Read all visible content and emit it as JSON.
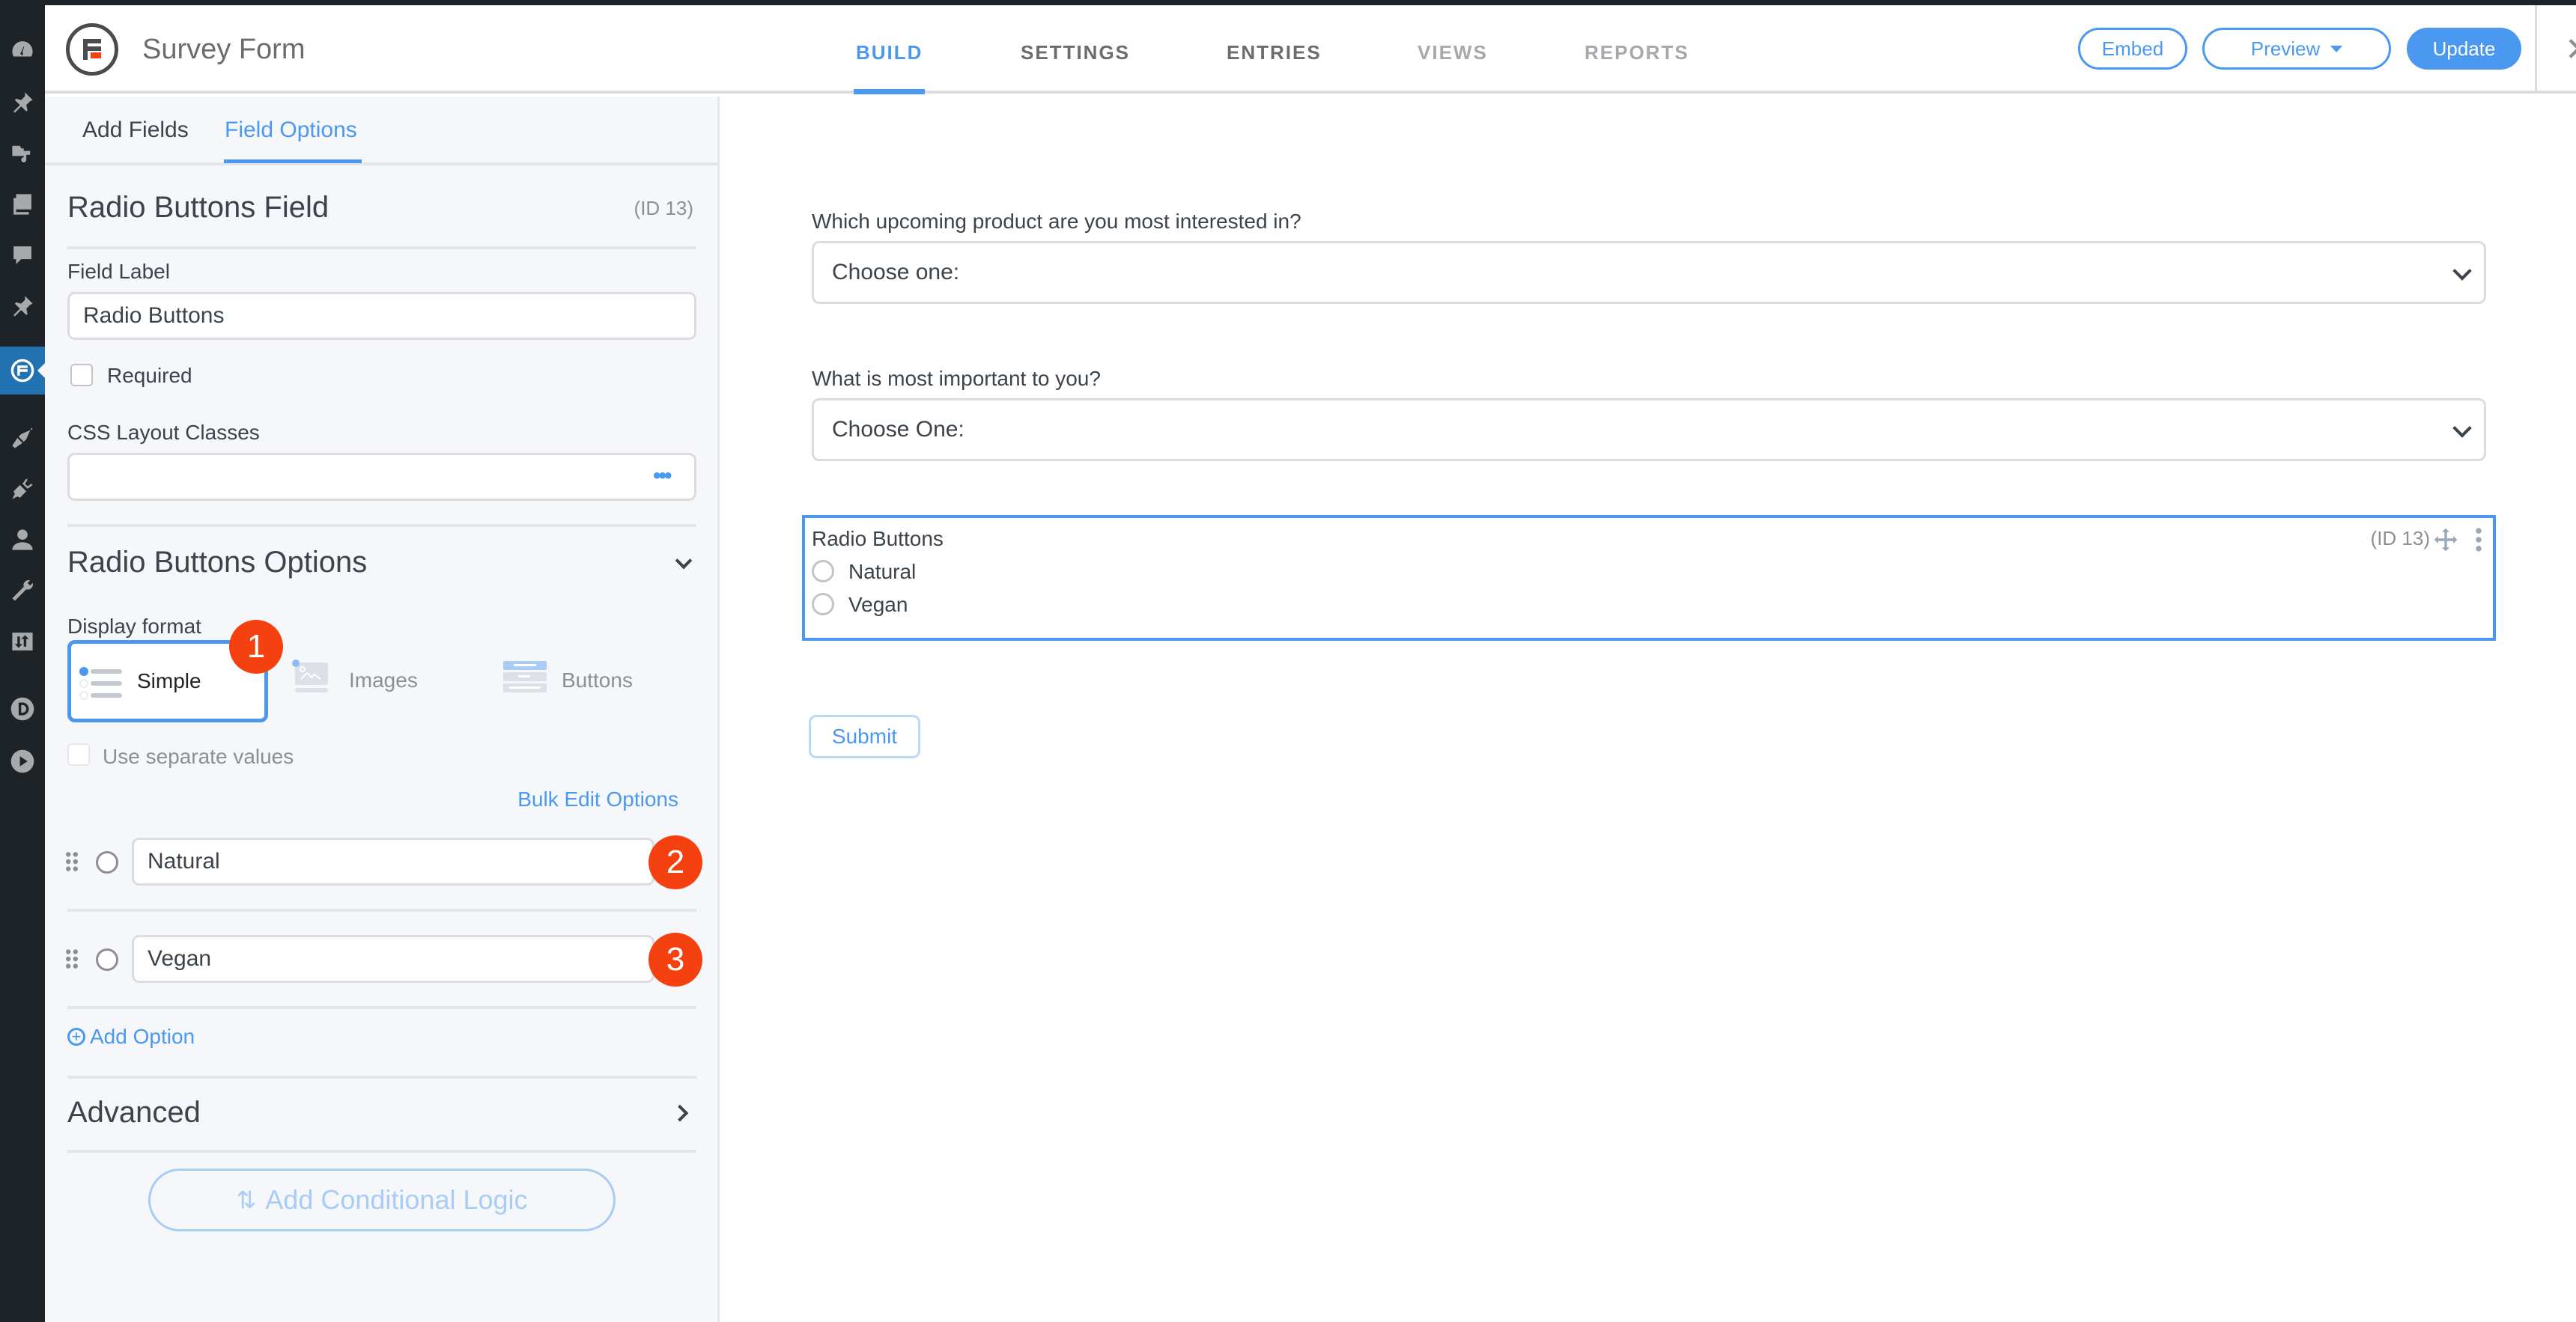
{
  "header": {
    "form_title": "Survey Form",
    "nav": [
      "BUILD",
      "SETTINGS",
      "ENTRIES",
      "VIEWS",
      "REPORTS"
    ],
    "active_nav": "BUILD",
    "embed_label": "Embed",
    "preview_label": "Preview",
    "update_label": "Update"
  },
  "colors": {
    "accent": "#4a98f0",
    "badge": "#f4410f",
    "admin_bar": "#1d2327",
    "admin_active": "#2271b1"
  },
  "left_panel": {
    "tabs": [
      "Add Fields",
      "Field Options"
    ],
    "active_tab": "Field Options",
    "field_title": "Radio Buttons Field",
    "field_id": "(ID 13)",
    "field_label_label": "Field Label",
    "field_label_value": "Radio Buttons",
    "required_label": "Required",
    "required_checked": false,
    "css_classes_label": "CSS Layout Classes",
    "css_classes_value": "",
    "options_section_title": "Radio Buttons Options",
    "display_format_label": "Display format",
    "display_formats": [
      "Simple",
      "Images",
      "Buttons"
    ],
    "selected_format": "Simple",
    "use_separate_values_label": "Use separate values",
    "bulk_edit_label": "Bulk Edit Options",
    "options": [
      "Natural",
      "Vegan"
    ],
    "add_option_label": "Add Option",
    "advanced_label": "Advanced",
    "conditional_logic_label": "Add Conditional Logic",
    "badges": [
      "1",
      "2",
      "3"
    ]
  },
  "form": {
    "q1_label": "Which upcoming product are you most interested in?",
    "q1_value": "Choose one:",
    "q2_label": "What is most important to you?",
    "q2_value": "Choose One:",
    "radio_label": "Radio Buttons",
    "radio_id": "(ID 13)",
    "radio_options": [
      "Natural",
      "Vegan"
    ],
    "submit_label": "Submit"
  }
}
